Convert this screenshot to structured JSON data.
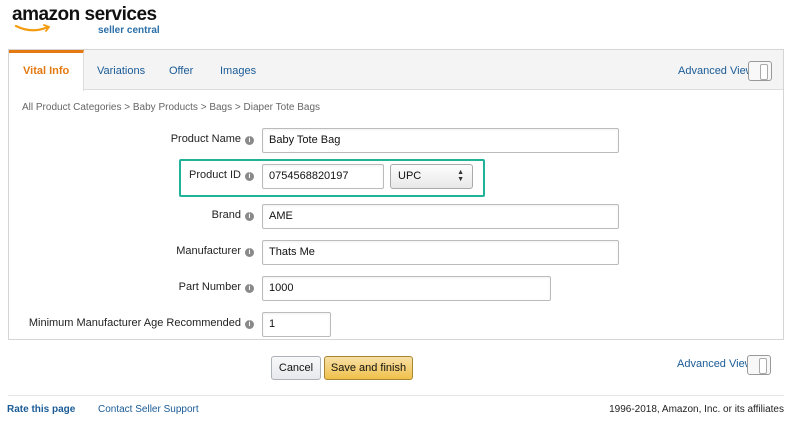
{
  "brand": {
    "logo_main": "amazon services",
    "logo_sub": "seller central"
  },
  "tabs": [
    {
      "label": "Vital Info",
      "active": true
    },
    {
      "label": "Variations",
      "active": false
    },
    {
      "label": "Offer",
      "active": false
    },
    {
      "label": "Images",
      "active": false
    }
  ],
  "advanced_view_label": "Advanced View",
  "breadcrumb": "All Product Categories > Baby Products > Bags > Diaper Tote Bags",
  "form": {
    "product_name": {
      "label": "Product Name",
      "value": "Baby Tote Bag"
    },
    "product_id": {
      "label": "Product ID",
      "value": "0754568820197",
      "type_selected": "UPC"
    },
    "brand": {
      "label": "Brand",
      "value": "AME"
    },
    "manufacturer": {
      "label": "Manufacturer",
      "value": "Thats Me"
    },
    "part_number": {
      "label": "Part Number",
      "value": "1000"
    },
    "min_age": {
      "label": "Minimum Manufacturer Age Recommended",
      "value": "1"
    }
  },
  "actions": {
    "cancel_label": "Cancel",
    "save_label": "Save and finish"
  },
  "footer": {
    "rate_label": "Rate this page",
    "contact_label": "Contact Seller Support",
    "copyright": "1996-2018, Amazon, Inc. or its affiliates"
  },
  "colors": {
    "accent_orange": "#e47911",
    "link_blue": "#1a5b96",
    "highlight_teal": "#21b29a",
    "save_yellow": "#f0c14b"
  },
  "icons": {
    "info": "info-circle-icon",
    "select_arrows": "up-down-arrows-icon"
  }
}
